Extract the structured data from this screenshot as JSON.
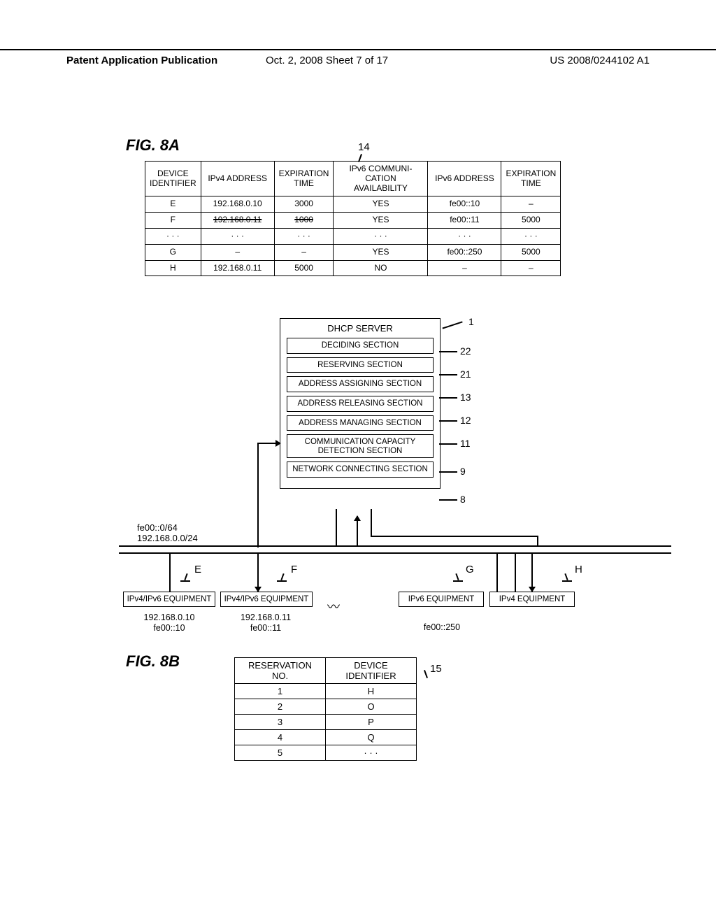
{
  "header": {
    "left": "Patent Application Publication",
    "middle": "Oct. 2, 2008  Sheet 7 of 17",
    "right": "US 2008/0244102 A1"
  },
  "fig8a_label": "FIG. 8A",
  "fig8b_label": "FIG. 8B",
  "table14_ref": "14",
  "table15_ref": "15",
  "tbl14": {
    "headers": [
      "DEVICE IDENTIFIER",
      "IPv4 ADDRESS",
      "EXPIRATION TIME",
      "IPv6 COMMUNI-CATION AVAILABILITY",
      "IPv6 ADDRESS",
      "EXPIRATION TIME"
    ],
    "rows": [
      {
        "dev": "E",
        "v4": "192.168.0.10",
        "ex1": "3000",
        "av": "YES",
        "v6": "fe00::10",
        "ex2": "–"
      },
      {
        "dev": "F",
        "v4": "192.168.0.11",
        "ex1": "1000",
        "av": "YES",
        "v6": "fe00::11",
        "ex2": "5000",
        "strike": true
      },
      {
        "dev": "· · ·",
        "v4": "· · ·",
        "ex1": "· · ·",
        "av": "· · ·",
        "v6": "· · ·",
        "ex2": "· · ·"
      },
      {
        "dev": "G",
        "v4": "–",
        "ex1": "–",
        "av": "YES",
        "v6": "fe00::250",
        "ex2": "5000"
      },
      {
        "dev": "H",
        "v4": "192.168.0.11",
        "ex1": "5000",
        "av": "NO",
        "v6": "–",
        "ex2": "–"
      }
    ]
  },
  "server": {
    "title": "DHCP SERVER",
    "sections": [
      {
        "label": "DECIDING SECTION",
        "ref": "22"
      },
      {
        "label": "RESERVING SECTION",
        "ref": "21"
      },
      {
        "label": "ADDRESS ASSIGNING SECTION",
        "ref": "13"
      },
      {
        "label": "ADDRESS RELEASING SECTION",
        "ref": "12"
      },
      {
        "label": "ADDRESS MANAGING SECTION",
        "ref": "11"
      },
      {
        "label": "COMMUNICATION CAPACITY DETECTION SECTION",
        "ref": "9",
        "two": true
      },
      {
        "label": "NETWORK CONNECTING SECTION",
        "ref": "8"
      }
    ],
    "ref": "1"
  },
  "network": {
    "prefix_v6": "fe00::0/64",
    "prefix_v4": "192.168.0.0/24",
    "equipment": [
      {
        "letter": "E",
        "type": "IPv4/IPv6 EQUIPMENT",
        "addr1": "192.168.0.10",
        "addr2": "fe00::10"
      },
      {
        "letter": "F",
        "type": "IPv4/IPv6 EQUIPMENT",
        "addr1": "192.168.0.11",
        "addr2": "fe00::11"
      },
      {
        "letter": "G",
        "type": "IPv6 EQUIPMENT",
        "addr1": "",
        "addr2": "fe00::250"
      },
      {
        "letter": "H",
        "type": "IPv4 EQUIPMENT",
        "addr1": "",
        "addr2": ""
      }
    ]
  },
  "tbl15": {
    "headers": [
      "RESERVATION NO.",
      "DEVICE IDENTIFIER"
    ],
    "rows": [
      {
        "n": "1",
        "d": "H"
      },
      {
        "n": "2",
        "d": "O"
      },
      {
        "n": "3",
        "d": "P"
      },
      {
        "n": "4",
        "d": "Q"
      },
      {
        "n": "5",
        "d": "· · ·"
      }
    ]
  }
}
